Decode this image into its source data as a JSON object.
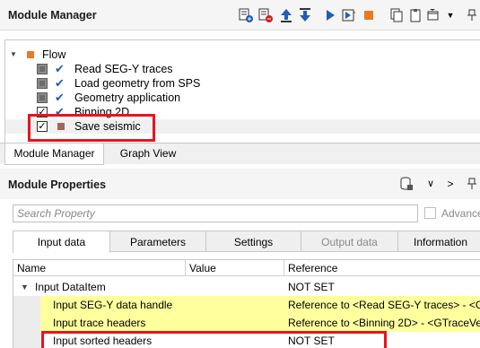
{
  "module_manager": {
    "title": "Module Manager",
    "toolbar_icons": [
      "add-module-icon",
      "remove-module-icon",
      "move-up-icon",
      "move-down-icon",
      "run-icon",
      "run-step-icon",
      "stop-icon",
      "copy-icon",
      "paste-icon",
      "window-menu-icon",
      "pin-icon"
    ],
    "tree": {
      "root_label": "Flow",
      "items": [
        {
          "label": "Read SEG-Y traces"
        },
        {
          "label": "Load geometry from SPS"
        },
        {
          "label": "Geometry application"
        },
        {
          "label": "Binning 2D"
        },
        {
          "label": "Save seismic"
        }
      ]
    },
    "tabs": [
      {
        "label": "Module Manager"
      },
      {
        "label": "Graph View"
      }
    ]
  },
  "module_properties": {
    "title": "Module Properties",
    "search_placeholder": "Search Property",
    "advanced_label": "Advance",
    "tabs": [
      {
        "label": "Input data"
      },
      {
        "label": "Parameters"
      },
      {
        "label": "Settings"
      },
      {
        "label": "Output data"
      },
      {
        "label": "Information"
      }
    ],
    "grid": {
      "columns": [
        "Name",
        "Value",
        "Reference"
      ],
      "group": {
        "name": "Input DataItem",
        "reference": "NOT SET"
      },
      "rows": [
        {
          "name": "Input SEG-Y data handle",
          "value": "",
          "reference": "Reference to <Read SEG-Y traces> - <GR"
        },
        {
          "name": "Input trace headers",
          "value": "",
          "reference": "Reference to <Binning 2D> - <GTraceVec"
        },
        {
          "name": "Input sorted headers",
          "value": "",
          "reference": "NOT SET"
        }
      ]
    }
  },
  "colors": {
    "flow_square": "#e87b22",
    "check_blue": "#1f5fb0",
    "highlight_red": "#e8141e",
    "row_yellow": "#ffff9e"
  }
}
